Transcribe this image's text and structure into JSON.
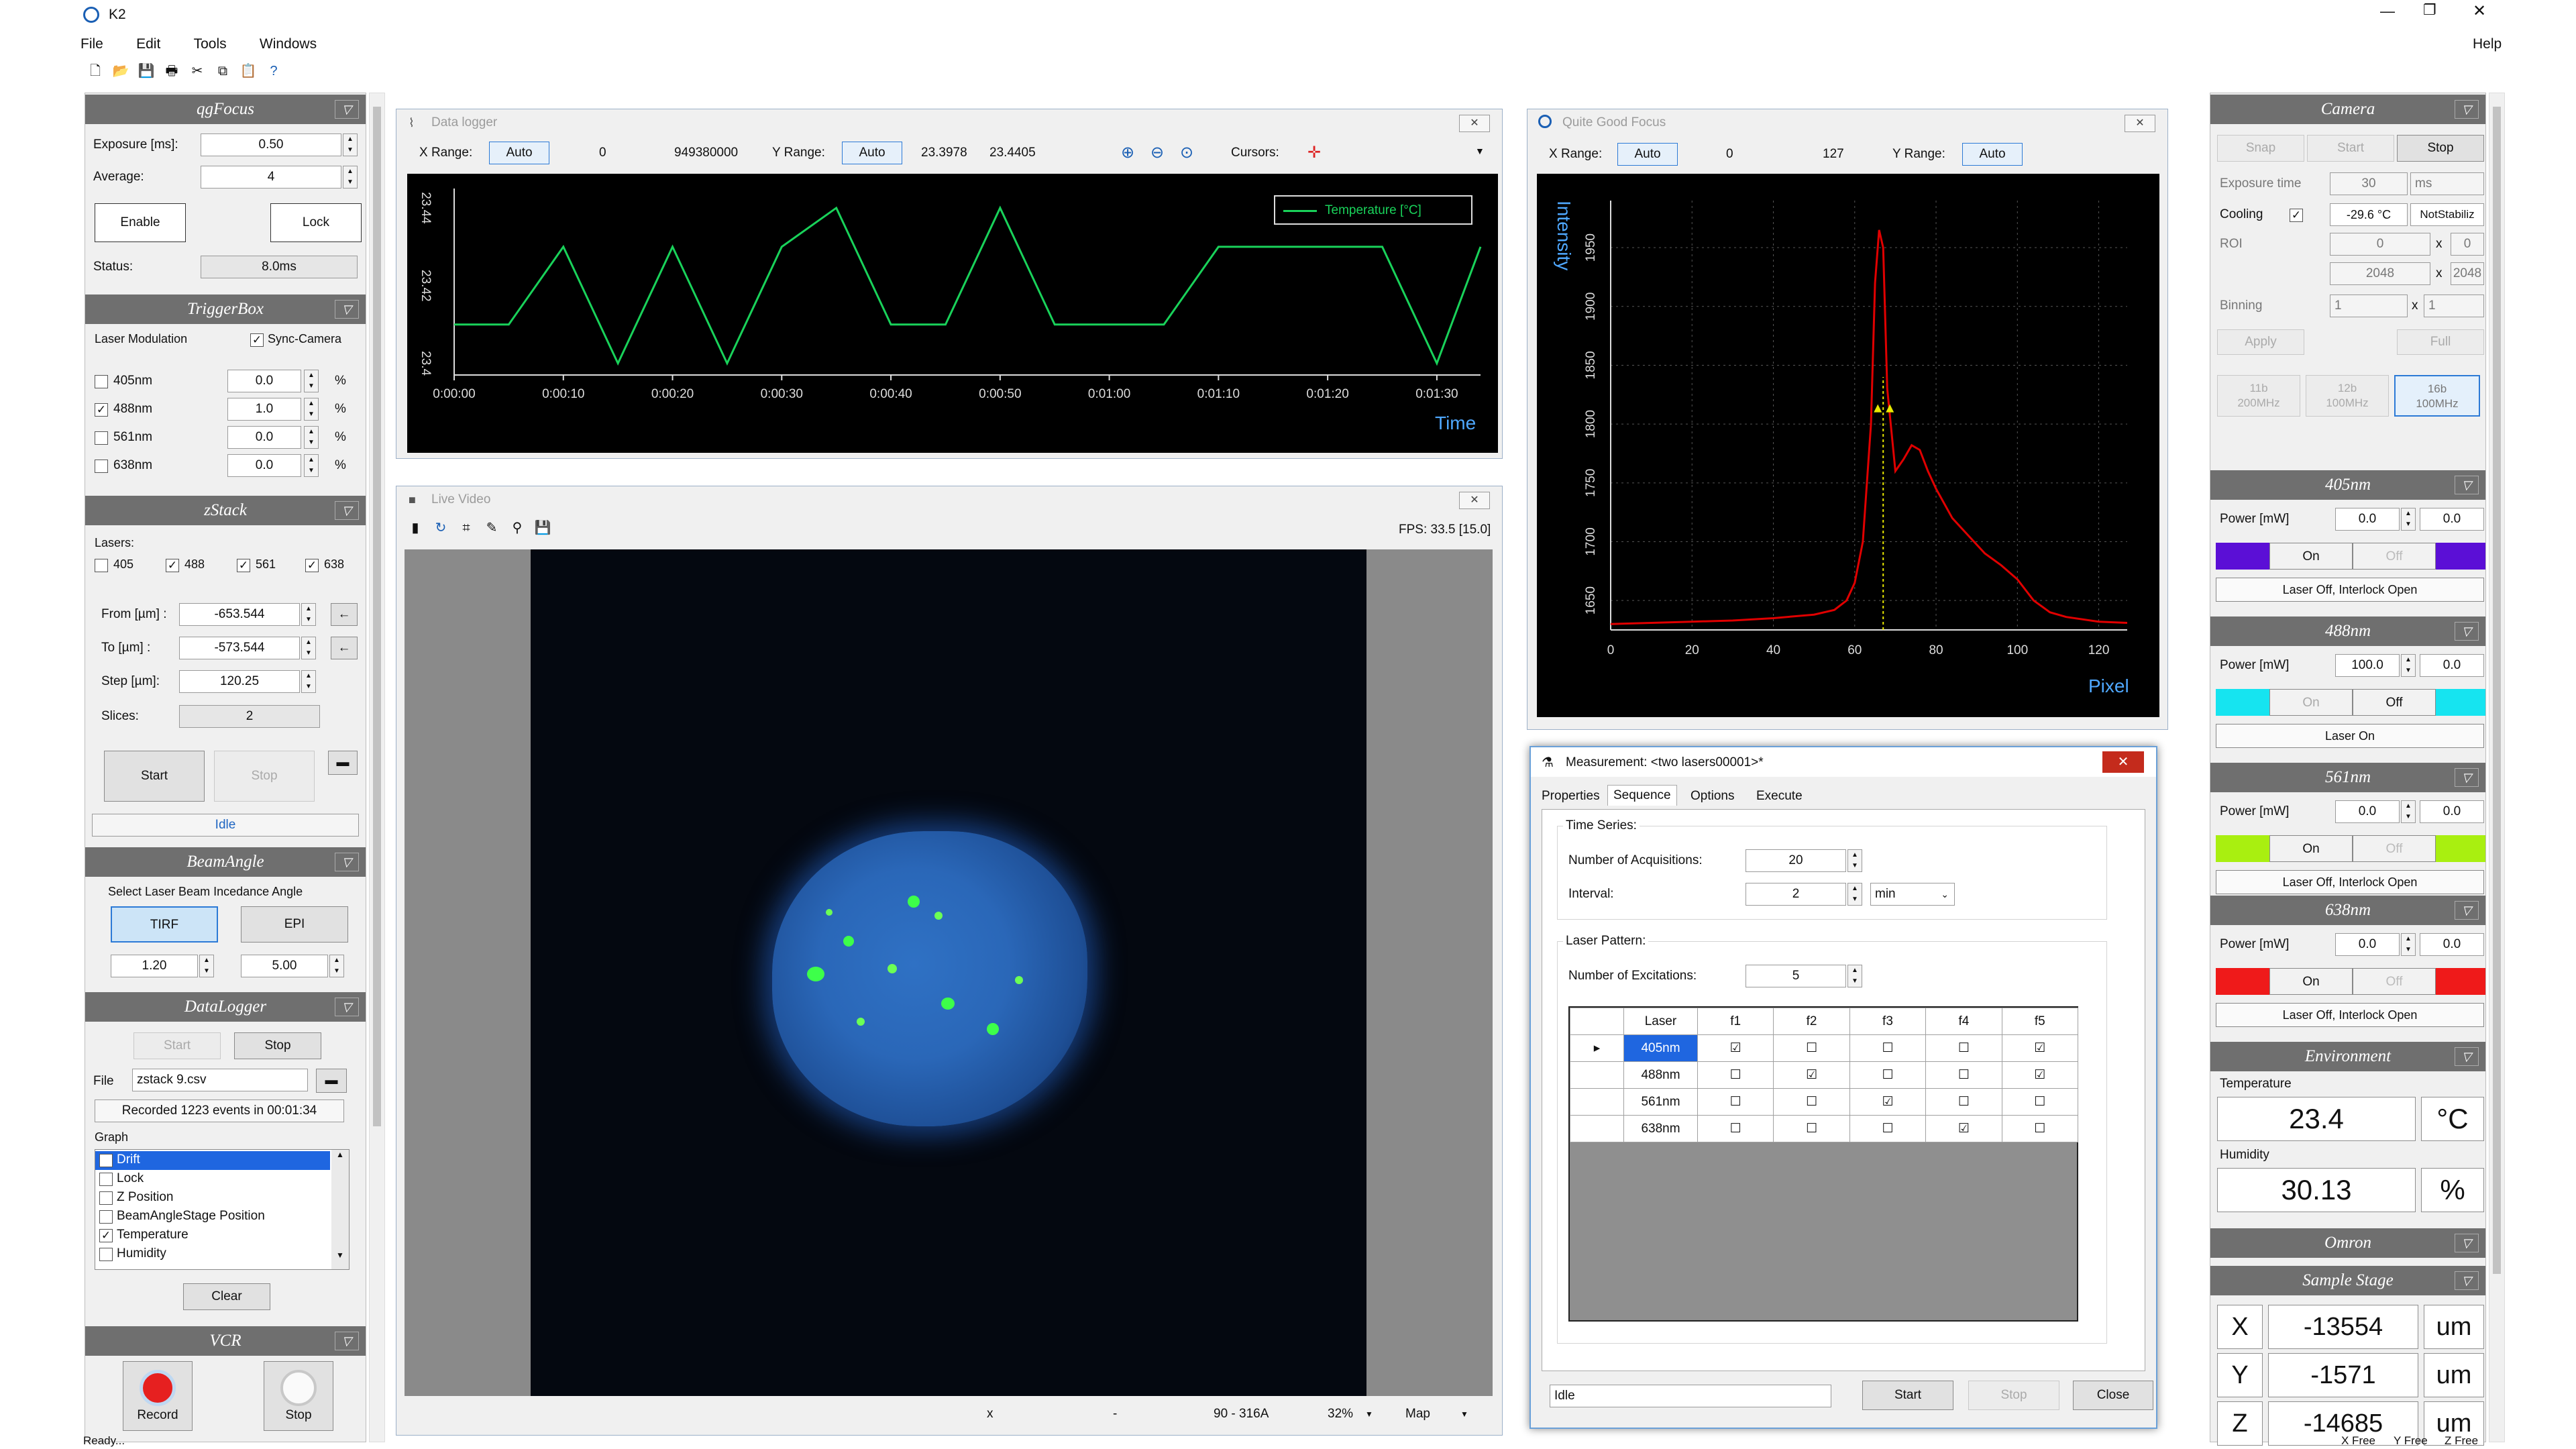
{
  "app": {
    "title": "K2",
    "help": "Help"
  },
  "menu": [
    "File",
    "Edit",
    "Tools",
    "Windows"
  ],
  "status": {
    "left": "Ready...",
    "right": [
      "X Free",
      "Y Free",
      "Z Free"
    ]
  },
  "left": {
    "qgfocus": {
      "title": "qgFocus",
      "exposure_label": "Exposure [ms]:",
      "exposure": "0.50",
      "average_label": "Average:",
      "average": "4",
      "enable": "Enable",
      "lock": "Lock",
      "status_label": "Status:",
      "status": "8.0ms"
    },
    "triggerbox": {
      "title": "TriggerBox",
      "modulation": "Laser Modulation",
      "sync": "Sync-Camera",
      "lasers": [
        {
          "name": "405nm",
          "checked": false,
          "value": "0.0"
        },
        {
          "name": "488nm",
          "checked": true,
          "value": "1.0"
        },
        {
          "name": "561nm",
          "checked": false,
          "value": "0.0"
        },
        {
          "name": "638nm",
          "checked": false,
          "value": "0.0"
        }
      ],
      "unit": "%"
    },
    "zstack": {
      "title": "zStack",
      "lasers_label": "Lasers:",
      "lasers": [
        {
          "name": "405",
          "checked": false
        },
        {
          "name": "488",
          "checked": true
        },
        {
          "name": "561",
          "checked": true
        },
        {
          "name": "638",
          "checked": true
        }
      ],
      "from_label": "From [µm] :",
      "from": "-653.544",
      "to_label": "To [µm] :",
      "to": "-573.544",
      "step_label": "Step [µm]:",
      "step": "120.25",
      "slices_label": "Slices:",
      "slices": "2",
      "start": "Start",
      "stop": "Stop",
      "state": "Idle",
      "arrow": "←"
    },
    "beamangle": {
      "title": "BeamAngle",
      "caption": "Select Laser Beam Incedance Angle",
      "tirf": "TIRF",
      "epi": "EPI",
      "tirf_val": "1.20",
      "epi_val": "5.00"
    },
    "datalogger": {
      "title": "DataLogger",
      "start": "Start",
      "stop": "Stop",
      "file_label": "File",
      "file": "zstack 9.csv",
      "recorded": "Recorded 1223 events in 00:01:34",
      "graph_label": "Graph",
      "graphs": [
        {
          "name": "Drift",
          "checked": false
        },
        {
          "name": "Lock",
          "checked": false
        },
        {
          "name": "Z Position",
          "checked": false
        },
        {
          "name": "BeamAngleStage Position",
          "checked": false
        },
        {
          "name": "Temperature",
          "checked": true
        },
        {
          "name": "Humidity",
          "checked": false
        }
      ],
      "clear": "Clear"
    },
    "vcr": {
      "title": "VCR",
      "record": "Record",
      "stop": "Stop"
    }
  },
  "datalogger_win": {
    "title": "Data logger",
    "xrange_label": "X Range:",
    "x_auto": "Auto",
    "x_min": "0",
    "x_max": "949380000",
    "yrange_label": "Y Range:",
    "y_auto": "Auto",
    "y_min": "23.3978",
    "y_max": "23.4405",
    "cursors": "Cursors:",
    "time_label": "Time"
  },
  "live_video": {
    "title": "Live Video",
    "fps": "FPS: 33.5 [15.0]",
    "status": [
      "x",
      "-",
      "90 - 316A",
      "32%",
      "Map"
    ]
  },
  "focus_win": {
    "title": "Quite Good Focus",
    "xrange_label": "X Range:",
    "x_auto": "Auto",
    "x_min": "0",
    "x_max": "127",
    "yrange_label": "Y Range:",
    "y_auto": "Auto",
    "ylabel": "Intensity",
    "xlabel": "Pixel"
  },
  "measurement": {
    "title": "Measurement: <two lasers00001>*",
    "tabs": [
      "Properties",
      "Sequence",
      "Options",
      "Execute"
    ],
    "time_series": "Time Series:",
    "acq_label": "Number of Acquisitions:",
    "acq": "20",
    "interval_label": "Interval:",
    "interval": "2",
    "interval_unit": "min",
    "laser_pattern": "Laser Pattern:",
    "exc_label": "Number of Excitations:",
    "exc": "5",
    "grid_header": [
      "Laser",
      "f1",
      "f2",
      "f3",
      "f4",
      "f5"
    ],
    "grid_rows": [
      {
        "laser": "405nm",
        "f": [
          true,
          false,
          false,
          false,
          true
        ]
      },
      {
        "laser": "488nm",
        "f": [
          false,
          true,
          false,
          false,
          true
        ]
      },
      {
        "laser": "561nm",
        "f": [
          false,
          false,
          true,
          false,
          false
        ]
      },
      {
        "laser": "638nm",
        "f": [
          false,
          false,
          false,
          true,
          false
        ]
      }
    ],
    "state": "Idle",
    "start": "Start",
    "stop": "Stop",
    "close": "Close"
  },
  "right": {
    "camera": {
      "title": "Camera",
      "snap": "Snap",
      "start": "Start",
      "stop": "Stop",
      "exposure_label": "Exposure time",
      "exposure": "30",
      "exposure_unit": "ms",
      "cooling_label": "Cooling",
      "cooling": "-29.6 °C",
      "cooling_state": "NotStabiliz",
      "roi_label": "ROI",
      "roi": [
        "0",
        "0",
        "2048",
        "2048"
      ],
      "x": "x",
      "binning_label": "Binning",
      "binning": [
        "1",
        "1"
      ],
      "apply": "Apply",
      "full": "Full",
      "modes": [
        "11b\n200MHz",
        "12b\n100MHz",
        "16b\n100MHz"
      ]
    },
    "lasers": [
      {
        "title": "405nm",
        "power_label": "Power [mW]",
        "power": "0.0",
        "actual": "0.0",
        "on": "On",
        "off": "Off",
        "state": "Laser Off, Interlock Open",
        "color": "#5b0fd6",
        "on_active": true
      },
      {
        "title": "488nm",
        "power_label": "Power [mW]",
        "power": "100.0",
        "actual": "0.0",
        "on": "On",
        "off": "Off",
        "state": "Laser On",
        "color": "#16e4f0",
        "on_active": false
      },
      {
        "title": "561nm",
        "power_label": "Power [mW]",
        "power": "0.0",
        "actual": "0.0",
        "on": "On",
        "off": "Off",
        "state": "Laser Off, Interlock Open",
        "color": "#a9ef10",
        "on_active": true
      },
      {
        "title": "638nm",
        "power_label": "Power [mW]",
        "power": "0.0",
        "actual": "0.0",
        "on": "On",
        "off": "Off",
        "state": "Laser Off, Interlock Open",
        "color": "#ef1a1a",
        "on_active": true
      }
    ],
    "environment": {
      "title": "Environment",
      "temp_label": "Temperature",
      "temp": "23.4",
      "temp_unit": "°C",
      "hum_label": "Humidity",
      "hum": "30.13",
      "hum_unit": "%"
    },
    "omron": {
      "title": "Omron"
    },
    "stage": {
      "title": "Sample Stage",
      "axes": [
        {
          "axis": "X",
          "value": "-13554",
          "unit": "um"
        },
        {
          "axis": "Y",
          "value": "-1571",
          "unit": "um"
        },
        {
          "axis": "Z",
          "value": "-14685",
          "unit": "um"
        }
      ]
    }
  },
  "colors": {
    "section": "#6f6f6f",
    "accent": "#cce4f7",
    "trace_green": "#19d25a",
    "trace_red": "#e00000"
  },
  "chart_data": [
    {
      "type": "line",
      "title": "",
      "xlabel": "Time",
      "ylabel": "",
      "x": [
        "0:00:00",
        "0:00:05",
        "0:00:10",
        "0:00:15",
        "0:00:20",
        "0:00:25",
        "0:00:30",
        "0:00:35",
        "0:00:40",
        "0:00:45",
        "0:00:50",
        "0:00:55",
        "0:01:00",
        "0:01:05",
        "0:01:10",
        "0:01:15",
        "0:01:20",
        "0:01:25",
        "0:01:30",
        "0:01:34"
      ],
      "x_ticks": [
        "0:00:00",
        "0:00:10",
        "0:00:20",
        "0:00:30",
        "0:00:40",
        "0:00:50",
        "0:01:00",
        "0:01:10",
        "0:01:20",
        "0:01:30"
      ],
      "series": [
        {
          "name": "Temperature [°C]",
          "values": [
            23.41,
            23.41,
            23.43,
            23.4,
            23.43,
            23.4,
            23.43,
            23.44,
            23.41,
            23.41,
            23.44,
            23.41,
            23.41,
            23.41,
            23.43,
            23.43,
            23.43,
            23.43,
            23.4,
            23.43
          ]
        }
      ],
      "y_ticks": [
        "23.4",
        "23.42",
        "23.44"
      ],
      "ylim": [
        23.397,
        23.445
      ],
      "legend": "top-right"
    },
    {
      "type": "line",
      "title": "",
      "xlabel": "Pixel",
      "ylabel": "Intensity",
      "x_ticks": [
        "0",
        "20",
        "40",
        "60",
        "80",
        "100",
        "120"
      ],
      "y_ticks": [
        "1650",
        "1700",
        "1750",
        "1800",
        "1850",
        "1900",
        "1950"
      ],
      "xlim": [
        0,
        127
      ],
      "ylim": [
        1625,
        1990
      ],
      "series": [
        {
          "name": "",
          "x": [
            0,
            10,
            20,
            30,
            40,
            50,
            55,
            58,
            60,
            62,
            64,
            65,
            66,
            67,
            68,
            70,
            72,
            74,
            76,
            78,
            80,
            84,
            88,
            92,
            96,
            100,
            104,
            108,
            112,
            120,
            127
          ],
          "values": [
            1630,
            1631,
            1632,
            1633,
            1635,
            1638,
            1642,
            1650,
            1665,
            1700,
            1800,
            1920,
            1965,
            1950,
            1830,
            1760,
            1770,
            1782,
            1778,
            1760,
            1745,
            1720,
            1705,
            1690,
            1680,
            1668,
            1650,
            1640,
            1636,
            1632,
            1631
          ]
        }
      ]
    }
  ]
}
